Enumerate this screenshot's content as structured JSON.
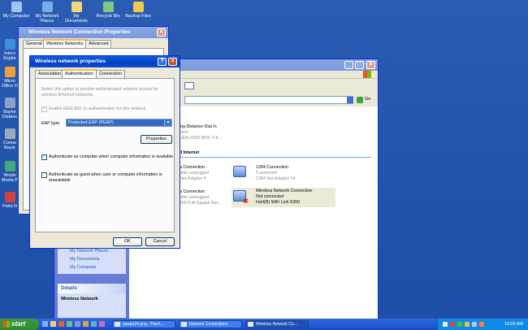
{
  "desktop": {
    "icons": [
      {
        "label": "My Computer",
        "color": "#9ec4f0"
      },
      {
        "label": "My Network Places",
        "color": "#6fb0e8"
      },
      {
        "label": "My Documents",
        "color": "#f3d77a"
      },
      {
        "label": "Recycle Bin",
        "color": "#7fc77f"
      },
      {
        "label": "Backup Files",
        "color": "#f2c94c"
      }
    ],
    "left_icons": [
      {
        "label": "Intern Explor",
        "color": "#3f8fe0"
      },
      {
        "label": "Micro Office O",
        "color": "#e9a23b"
      },
      {
        "label": "Baylor Distanc",
        "color": "#8aa0c8"
      },
      {
        "label": "Conne Baylo",
        "color": "#9ab"
      },
      {
        "label": "Windo Media P",
        "color": "#4a7"
      },
      {
        "label": "Paint.N",
        "color": "#c44"
      }
    ]
  },
  "wnc_props": {
    "title": "Wireless Network Connection Properties",
    "tabs": [
      "General",
      "Wireless Networks",
      "Advanced"
    ]
  },
  "wnp": {
    "title": "Wireless network properties",
    "tabs": [
      "Association",
      "Authentication",
      "Connection"
    ],
    "intro": "Select this option to provide authenticated network access for wireless Ethernet networks.",
    "enable_8021x": "Enable IEEE 802.1x authentication for this network",
    "eap_label": "EAP type:",
    "eap_value": "Protected EAP (PEAP)",
    "properties": "Properties",
    "auth_computer": "Authenticate as computer when computer information is available",
    "auth_guest": "Authenticate as guest when user or computer information is unavailable",
    "ok": "OK",
    "cancel": "Cancel"
  },
  "explorer": {
    "go": "Go",
    "dialin_title": "ing Distance Dial In",
    "dialin_sub1": "cted",
    "dialin_sub2": "HDA D330 MDC V.9...",
    "section": "d Internet",
    "items": [
      {
        "l1": "a Connection -",
        "l2": "able unplugged",
        "l3": "Net Adapter 4"
      },
      {
        "l1": "1394 Connection",
        "l2": "Connected",
        "l3": "1394 Net Adapter #4"
      },
      {
        "l1": "a Connection",
        "l2": "able unplugged",
        "l3": "2567LM Gigabit Net..."
      },
      {
        "l1": "Wireless Network Connection",
        "l2": "Not connected",
        "l3": "Intel(R) WiFi Link 5300"
      }
    ],
    "other_places": [
      "My Network Places",
      "My Documents",
      "My Computer"
    ],
    "details_head": "Details",
    "details_title": "Wireless Network"
  },
  "taskbar": {
    "start": "start",
    "items": [
      "xpwpa24.png - Paint....",
      "Network Connections",
      "Wireless Network Co..."
    ],
    "clock": "10:09 AM"
  }
}
